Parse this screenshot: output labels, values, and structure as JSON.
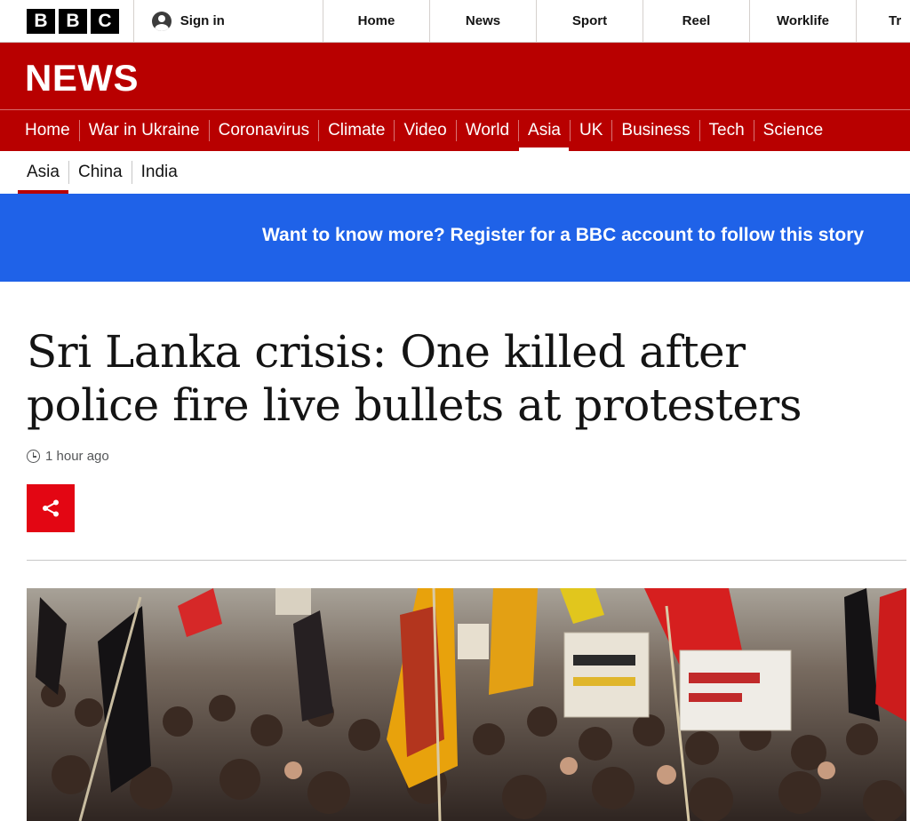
{
  "brand": {
    "letters": [
      "B",
      "B",
      "C"
    ]
  },
  "account": {
    "signin_label": "Sign in"
  },
  "top_nav": {
    "items": [
      "Home",
      "News",
      "Sport",
      "Reel",
      "Worklife",
      "Tr"
    ]
  },
  "news_header": {
    "title": "NEWS"
  },
  "section_nav": {
    "items": [
      "Home",
      "War in Ukraine",
      "Coronavirus",
      "Climate",
      "Video",
      "World",
      "Asia",
      "UK",
      "Business",
      "Tech",
      "Science"
    ],
    "active": "Asia"
  },
  "sub_nav": {
    "items": [
      "Asia",
      "China",
      "India"
    ],
    "active": "Asia"
  },
  "banner": {
    "text": "Want to know more? Register for a BBC account to follow this story"
  },
  "article": {
    "headline": "Sri Lanka crisis: One killed after police fire live bullets at protesters",
    "timestamp": "1 hour ago"
  },
  "colors": {
    "bbc_red": "#b80000",
    "banner_blue": "#1f62e8",
    "share_red": "#e30613"
  }
}
